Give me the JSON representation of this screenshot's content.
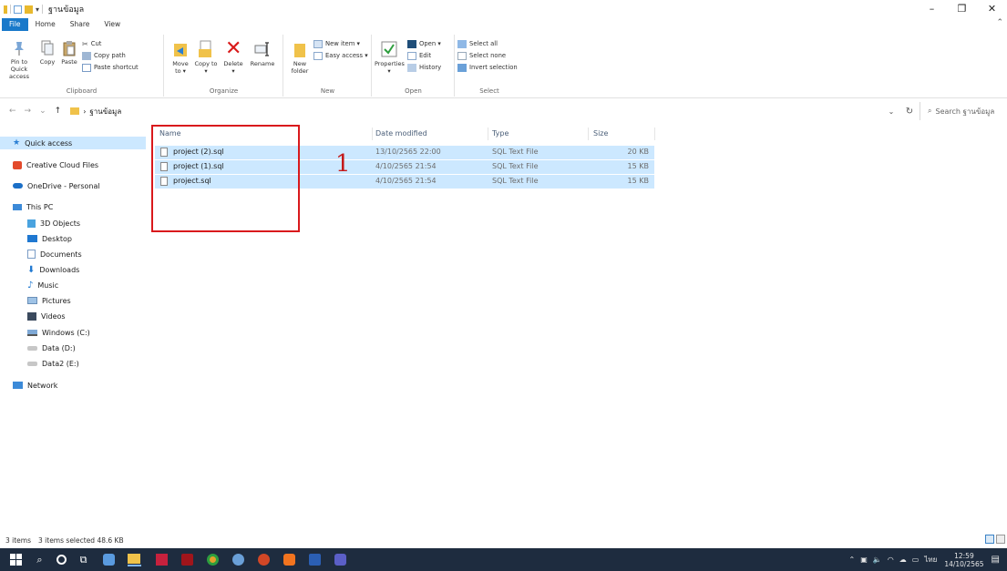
{
  "window": {
    "title": "ฐานข้อมูล",
    "qat_dropdown": "▾",
    "controls": {
      "minimize": "–",
      "maximize": "❐",
      "close": "✕"
    }
  },
  "tabs": [
    "File",
    "Home",
    "Share",
    "View"
  ],
  "ribbon": {
    "clipboard": {
      "label": "Clipboard",
      "pin": "Pin to Quick access",
      "copy": "Copy",
      "paste": "Paste",
      "cut": "Cut",
      "copy_path": "Copy path",
      "paste_shortcut": "Paste shortcut"
    },
    "organize": {
      "label": "Organize",
      "move_to": "Move to ▾",
      "copy_to": "Copy to ▾",
      "delete": "Delete ▾",
      "rename": "Rename"
    },
    "new": {
      "label": "New",
      "new_folder": "New folder",
      "new_item": "New item ▾",
      "easy_access": "Easy access ▾"
    },
    "open": {
      "label": "Open",
      "properties": "Properties ▾",
      "open": "Open ▾",
      "edit": "Edit",
      "history": "History"
    },
    "select": {
      "label": "Select",
      "select_all": "Select all",
      "select_none": "Select none",
      "invert_selection": "Invert selection"
    }
  },
  "address": {
    "path": "ฐานข้อมูล",
    "search_placeholder": "Search ฐานข้อมูล"
  },
  "navpane": {
    "quick_access": "Quick access",
    "creative_cloud": "Creative Cloud Files",
    "onedrive": "OneDrive - Personal",
    "this_pc": "This PC",
    "objects3d": "3D Objects",
    "desktop": "Desktop",
    "documents": "Documents",
    "downloads": "Downloads",
    "music": "Music",
    "pictures": "Pictures",
    "videos": "Videos",
    "windows_c": "Windows (C:)",
    "data_d": "Data (D:)",
    "data2_e": "Data2 (E:)",
    "network": "Network"
  },
  "columns": {
    "name": "Name",
    "date": "Date modified",
    "type": "Type",
    "size": "Size"
  },
  "files": [
    {
      "name": "project (2).sql",
      "date": "13/10/2565 22:00",
      "type": "SQL Text File",
      "size": "20 KB"
    },
    {
      "name": "project (1).sql",
      "date": "4/10/2565 21:54",
      "type": "SQL Text File",
      "size": "15 KB"
    },
    {
      "name": "project.sql",
      "date": "4/10/2565 21:54",
      "type": "SQL Text File",
      "size": "15 KB"
    }
  ],
  "annotation": "1",
  "status": {
    "items": "3 items",
    "selected": "3 items selected  48.6 KB"
  },
  "tray": {
    "lang": "ไทย",
    "time": "12:59",
    "date": "14/10/2565"
  },
  "colors": {
    "accent": "#1979ca",
    "selection": "#cce8ff",
    "annotation": "#d9191c",
    "taskbar": "#1e2c3f"
  }
}
